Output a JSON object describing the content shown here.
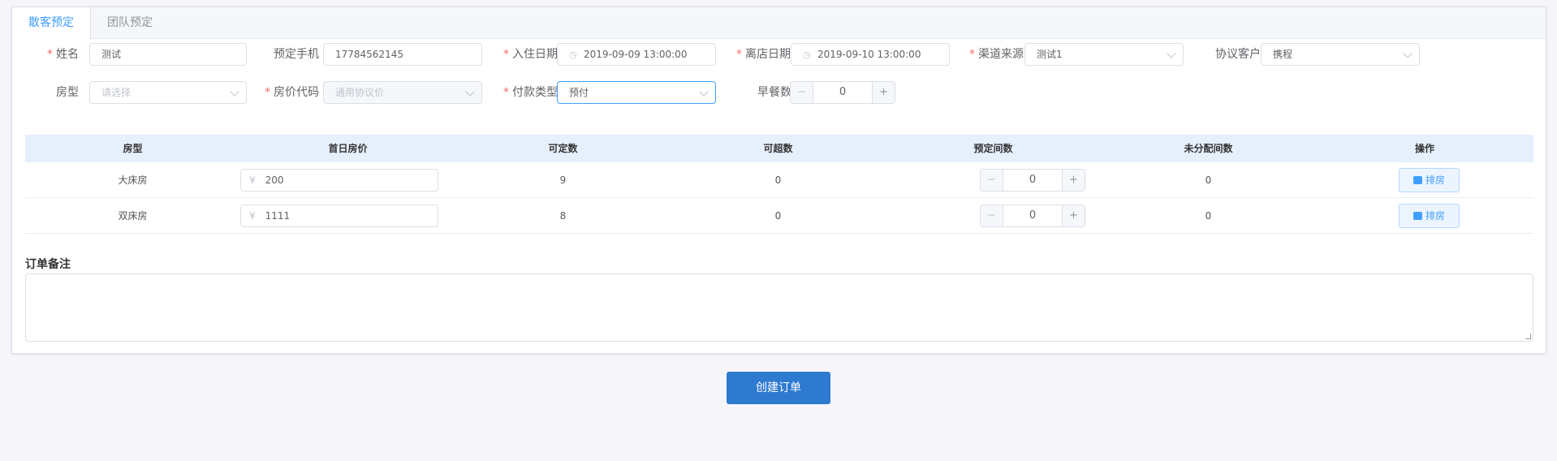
{
  "tabs": [
    {
      "label": "散客预定",
      "active": true
    },
    {
      "label": "团队预定",
      "active": false
    }
  ],
  "form": {
    "row1": {
      "name_label": "姓名",
      "name_value": "测试",
      "phone_label": "预定手机",
      "phone_value": "17784562145",
      "checkin_label": "入住日期",
      "checkin_value": "2019-09-09 13:00:00",
      "checkout_label": "离店日期",
      "checkout_value": "2019-09-10 13:00:00",
      "channel_label": "渠道来源",
      "channel_value": "测试1",
      "agreement_label": "协议客户",
      "agreement_value": "携程"
    },
    "row2": {
      "roomtype_label": "房型",
      "roomtype_placeholder": "请选择",
      "ratecode_label": "房价代码",
      "ratecode_value": "通用协议价",
      "paytype_label": "付款类型",
      "paytype_value": "预付",
      "breakfast_label": "早餐数",
      "breakfast_value": "0"
    },
    "required_mark": "*"
  },
  "table": {
    "headers": [
      "房型",
      "首日房价",
      "可定数",
      "可超数",
      "预定间数",
      "未分配间数",
      "操作"
    ],
    "rows": [
      {
        "room_type": "大床房",
        "price": "200",
        "available": "9",
        "overbook": "0",
        "booked": "0",
        "unassigned": "0",
        "action": "排房"
      },
      {
        "room_type": "双床房",
        "price": "1111",
        "available": "8",
        "overbook": "0",
        "booked": "0",
        "unassigned": "0",
        "action": "排房"
      }
    ],
    "currency_symbol": "¥",
    "stepper_minus": "−",
    "stepper_plus": "+"
  },
  "remark": {
    "label": "订单备注",
    "value": ""
  },
  "submit_label": "创建订单",
  "colors": {
    "accent": "#409eff",
    "primary_button": "#2f7ad1",
    "required": "#f56c6c",
    "table_header_bg": "#e6effc"
  }
}
